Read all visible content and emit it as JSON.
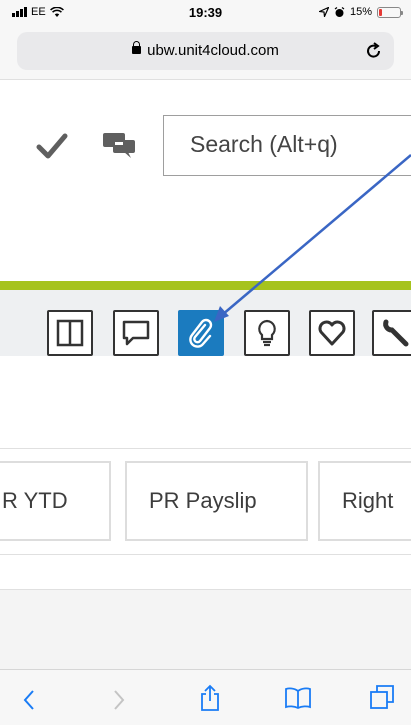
{
  "status_bar": {
    "carrier": "EE",
    "time": "19:39",
    "battery_percent": "15%",
    "battery_level": 0.15,
    "icons": [
      "signal-bars-icon",
      "wifi-icon",
      "location-icon",
      "alarm-icon",
      "battery-icon"
    ]
  },
  "browser": {
    "url": "ubw.unit4cloud.com",
    "lock_icon": "lock-icon",
    "reload_icon": "reload-icon"
  },
  "toolbar": {
    "check_icon": "checkmark-icon",
    "chat_icon": "chat-bubbles-icon",
    "search_placeholder": "Search (Alt+q)"
  },
  "icon_bar": {
    "accent_color": "#a6c31d",
    "active_color": "#1b7bbf",
    "buttons": [
      {
        "icon": "split-view-icon",
        "active": false
      },
      {
        "icon": "comment-icon",
        "active": false
      },
      {
        "icon": "paperclip-icon",
        "active": true
      },
      {
        "icon": "lightbulb-icon",
        "active": false
      },
      {
        "icon": "heart-icon",
        "active": false
      },
      {
        "icon": "wrench-icon",
        "active": false
      }
    ]
  },
  "annotation": {
    "arrow_color": "#3a66c4",
    "target": "paperclip-icon"
  },
  "tabs": [
    {
      "label": "R YTD"
    },
    {
      "label": "PR Payslip"
    },
    {
      "label": "Right"
    }
  ],
  "safari_nav": {
    "icons": [
      "back-icon",
      "forward-icon",
      "share-icon",
      "bookmarks-icon",
      "tabs-icon"
    ]
  }
}
